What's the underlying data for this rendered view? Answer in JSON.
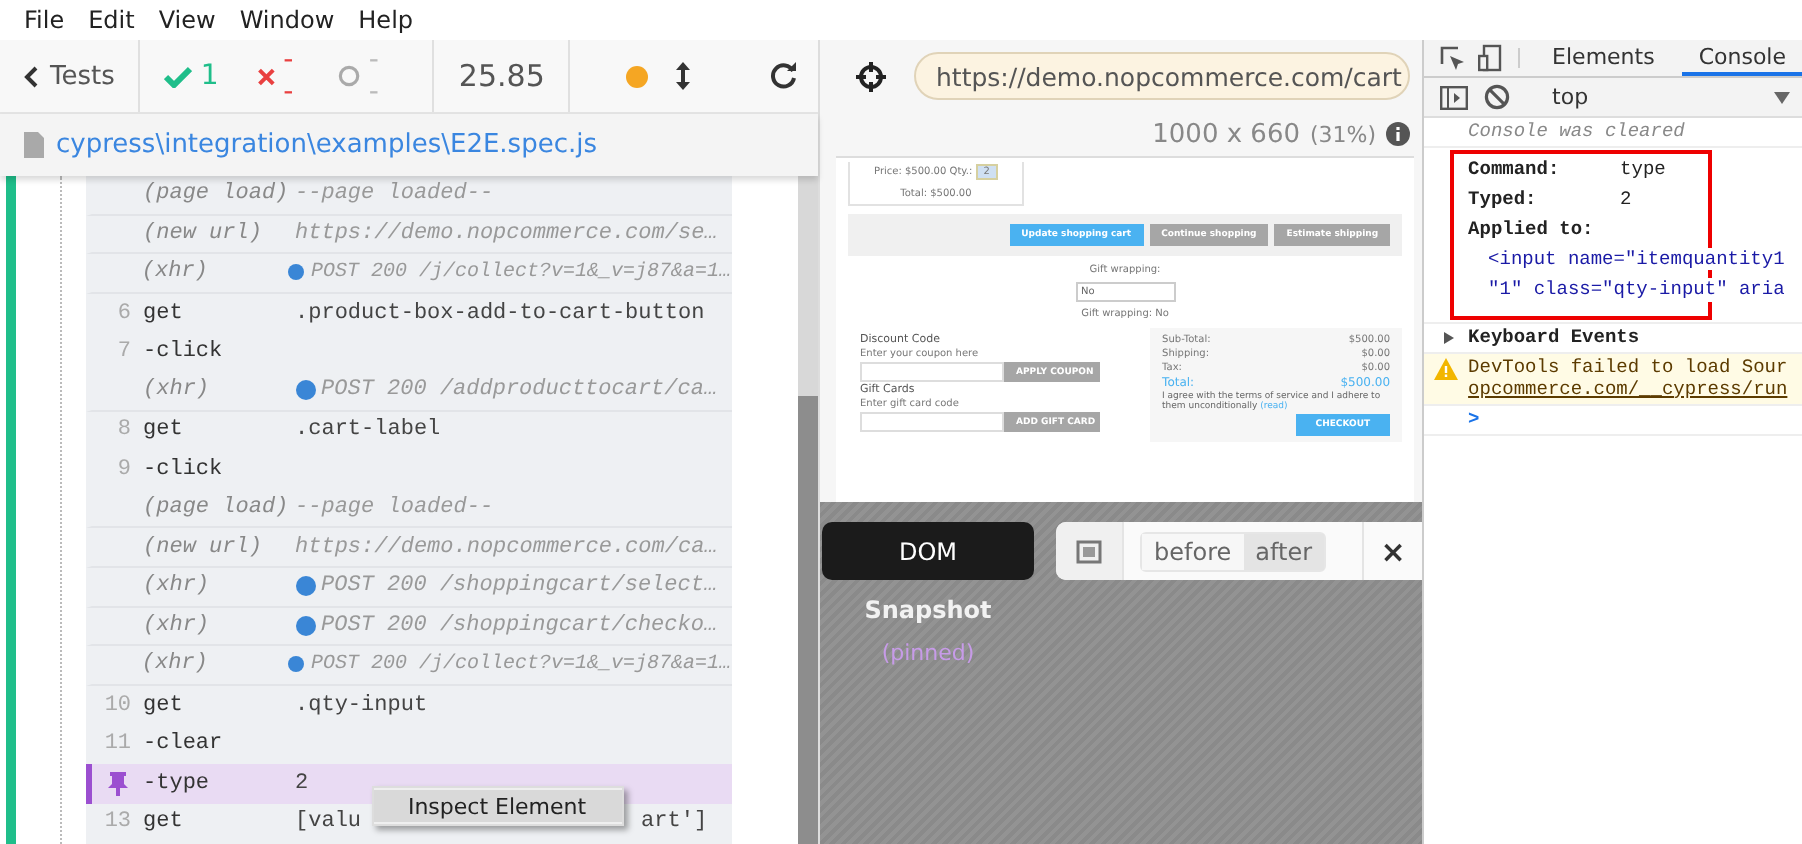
{
  "menu_bar": [
    "File",
    "Edit",
    "View",
    "Window",
    "Help"
  ],
  "header": {
    "back": "Tests",
    "passed": "1",
    "failed": "--",
    "pending": "--",
    "duration": "25.85"
  },
  "spec_path": "cypress\\integration\\examples\\E2E.spec.js",
  "commands": [
    {
      "kind": "event",
      "name": "(page load)",
      "message": "--page loaded--",
      "dot": false,
      "compact": false
    },
    {
      "kind": "event",
      "name": "(new url)",
      "message": "https://demo.nopcommerce.com/se…",
      "dot": false,
      "compact": false
    },
    {
      "kind": "event",
      "name": "(xhr)",
      "message": "POST 200 /j/collect?v=1&_v=j87&a=1…",
      "dot": true,
      "compact": true
    },
    {
      "kind": "command",
      "number": "6",
      "name": "get",
      "message": ".product-box-add-to-cart-button"
    },
    {
      "kind": "command",
      "number": "7",
      "name": "-click"
    },
    {
      "kind": "event",
      "name": "(xhr)",
      "message": "POST 200 /addproducttocart/ca…",
      "dot": true,
      "compact": false
    },
    {
      "kind": "command",
      "number": "8",
      "name": "get",
      "message": ".cart-label"
    },
    {
      "kind": "command",
      "number": "9",
      "name": "-click"
    },
    {
      "kind": "event",
      "name": "(page load)",
      "message": "--page loaded--",
      "dot": false,
      "compact": false
    },
    {
      "kind": "event",
      "name": "(new url)",
      "message": "https://demo.nopcommerce.com/ca…",
      "dot": false,
      "compact": false
    },
    {
      "kind": "event",
      "name": "(xhr)",
      "message": "POST 200 /shoppingcart/select…",
      "dot": true,
      "compact": false
    },
    {
      "kind": "event",
      "name": "(xhr)",
      "message": "POST 200 /shoppingcart/checko…",
      "dot": true,
      "compact": false
    },
    {
      "kind": "event",
      "name": "(xhr)",
      "message": "POST 200 /j/collect?v=1&_v=j87&a=1…",
      "dot": true,
      "compact": true
    },
    {
      "kind": "command",
      "number": "10",
      "name": "get",
      "message": ".qty-input"
    },
    {
      "kind": "command",
      "number": "11",
      "name": "-clear"
    },
    {
      "kind": "pinned",
      "name": "-type",
      "message": "2"
    },
    {
      "kind": "covered",
      "number": "13",
      "name": "get",
      "message": "[valu",
      "message_end": "art']"
    }
  ],
  "context_menu": [
    "Inspect Element"
  ],
  "url": "https://demo.nopcommerce.com/cart",
  "viewport": {
    "size": "1000 x 660",
    "scale": "(31%)"
  },
  "aut": {
    "price": "Price: $500.00",
    "qty_label": "Qty.:",
    "qty": "2",
    "total": "Total: $500.00",
    "buttons": [
      {
        "label": "Update shopping cart",
        "primary": true
      },
      {
        "label": "Continue shopping",
        "primary": false
      },
      {
        "label": "Estimate shipping",
        "primary": false
      }
    ],
    "gift_label": "Gift wrapping:",
    "gift_select": "No",
    "gift_note": "Gift wrapping: No",
    "discount_title": "Discount Code",
    "discount_hint": "Enter your coupon here",
    "apply": "APPLY COUPON",
    "giftcard_title": "Gift Cards",
    "giftcard_hint": "Enter gift card code",
    "add_gift": "ADD GIFT CARD",
    "totals": [
      {
        "label": "Sub-Total:",
        "value": "$500.00"
      },
      {
        "label": "Shipping:",
        "value": "$0.00"
      },
      {
        "label": "Tax:",
        "value": "$0.00"
      }
    ],
    "grand": {
      "label": "Total:",
      "value": "$500.00"
    },
    "terms": "I agree with the terms of service and I adhere to them unconditionally",
    "terms_link": "(read)",
    "checkout": "CHECKOUT"
  },
  "snapshot": {
    "dom": "DOM",
    "title": "Snapshot",
    "state": "(pinned)",
    "toggle": [
      {
        "label": "before",
        "selected": false
      },
      {
        "label": "after",
        "selected": true
      }
    ],
    "close": "×"
  },
  "devtools": {
    "tabs": [
      {
        "label": "Elements",
        "selected": false
      },
      {
        "label": "Console",
        "selected": true
      }
    ],
    "context": "top",
    "lines": [
      {
        "kind": "info",
        "text": "Console was cleared"
      },
      {
        "kind": "group",
        "rows": [
          {
            "key": "Command:",
            "value": "type"
          },
          {
            "key": "Typed:",
            "value": "2"
          }
        ],
        "applied_label": "Applied to:",
        "applied": [
          "<input name=\"itemquantity1",
          "\"1\" class=\"qty-input\" aria"
        ]
      },
      {
        "kind": "collapsed",
        "text": "Keyboard Events"
      },
      {
        "kind": "warning",
        "text": "DevTools failed to load Sour",
        "link": "opcommerce.com/__cypress/run"
      },
      {
        "kind": "prompt",
        "text": ">"
      }
    ]
  }
}
